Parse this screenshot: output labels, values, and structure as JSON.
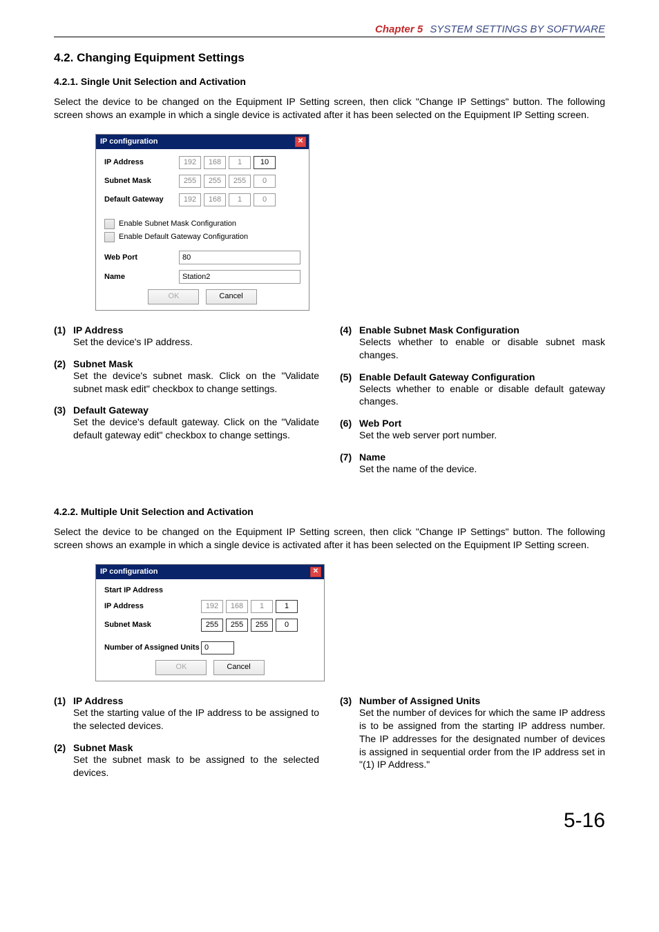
{
  "header": {
    "chapter": "Chapter 5",
    "title": "SYSTEM SETTINGS BY SOFTWARE"
  },
  "s42": {
    "title": "4.2. Changing Equipment Settings"
  },
  "s421": {
    "title": "4.2.1. Single Unit Selection and Activation",
    "intro": "Select the device to be changed on the Equipment IP Setting screen, then click \"Change IP Settings\" button. The following screen shows an example in which a single device is activated after it has been selected on the Equipment IP Setting screen."
  },
  "dlg1": {
    "title": "IP configuration",
    "ip_label": "IP Address",
    "ip": [
      "192",
      "168",
      "1",
      "10"
    ],
    "sm_label": "Subnet Mask",
    "sm": [
      "255",
      "255",
      "255",
      "0"
    ],
    "gw_label": "Default Gateway",
    "gw": [
      "192",
      "168",
      "1",
      "0"
    ],
    "cb1": "Enable Subnet Mask Configuration",
    "cb2": "Enable Default Gateway Configuration",
    "wp_label": "Web Port",
    "wp": "80",
    "nm_label": "Name",
    "nm": "Station2",
    "ok": "OK",
    "cancel": "Cancel"
  },
  "desc1": {
    "left": [
      {
        "n": "(1)",
        "t": "IP Address",
        "d": "Set the device's IP address."
      },
      {
        "n": "(2)",
        "t": "Subnet Mask",
        "d": "Set the device's subnet mask.\nClick on the \"Validate subnet mask edit\" checkbox to change settings."
      },
      {
        "n": "(3)",
        "t": "Default Gateway",
        "d": "Set the device's default gateway.\nClick on the \"Validate default gateway edit\" checkbox to change settings."
      }
    ],
    "right": [
      {
        "n": "(4)",
        "t": "Enable Subnet Mask Configuration",
        "d": "Selects whether to enable or disable subnet mask changes."
      },
      {
        "n": "(5)",
        "t": "Enable Default Gateway Configuration",
        "d": "Selects whether to enable or disable default gateway changes."
      },
      {
        "n": "(6)",
        "t": "Web Port",
        "d": "Set the web server port number."
      },
      {
        "n": "(7)",
        "t": "Name",
        "d": "Set the name of the device."
      }
    ]
  },
  "s422": {
    "title": "4.2.2. Multiple Unit Selection and Activation",
    "intro": "Select the device to be changed on the Equipment IP Setting screen, then click \"Change IP Settings\" button. The following screen shows an example in which a single device is activated after it has been selected on the Equipment IP Setting screen."
  },
  "dlg2": {
    "title": "IP configuration",
    "start": "Start IP Address",
    "ip_label": "IP Address",
    "ip": [
      "192",
      "168",
      "1",
      "1"
    ],
    "sm_label": "Subnet Mask",
    "sm": [
      "255",
      "255",
      "255",
      "0"
    ],
    "nu_label": "Number of Assigned Units",
    "nu": "0",
    "ok": "OK",
    "cancel": "Cancel"
  },
  "desc2": {
    "left": [
      {
        "n": "(1)",
        "t": "IP Address",
        "d": "Set the starting value of the IP address to be assigned to the selected devices."
      },
      {
        "n": "(2)",
        "t": "Subnet Mask",
        "d": "Set the subnet mask to be assigned to the selected devices."
      }
    ],
    "right": [
      {
        "n": "(3)",
        "t": "Number of Assigned Units",
        "d": "Set the number of devices for which the same IP address is to be assigned from the starting IP address number. The IP addresses for the designated number of devices is assigned in sequential order from the IP address set in \"(1) IP Address.\""
      }
    ]
  },
  "page_number": "5-16"
}
